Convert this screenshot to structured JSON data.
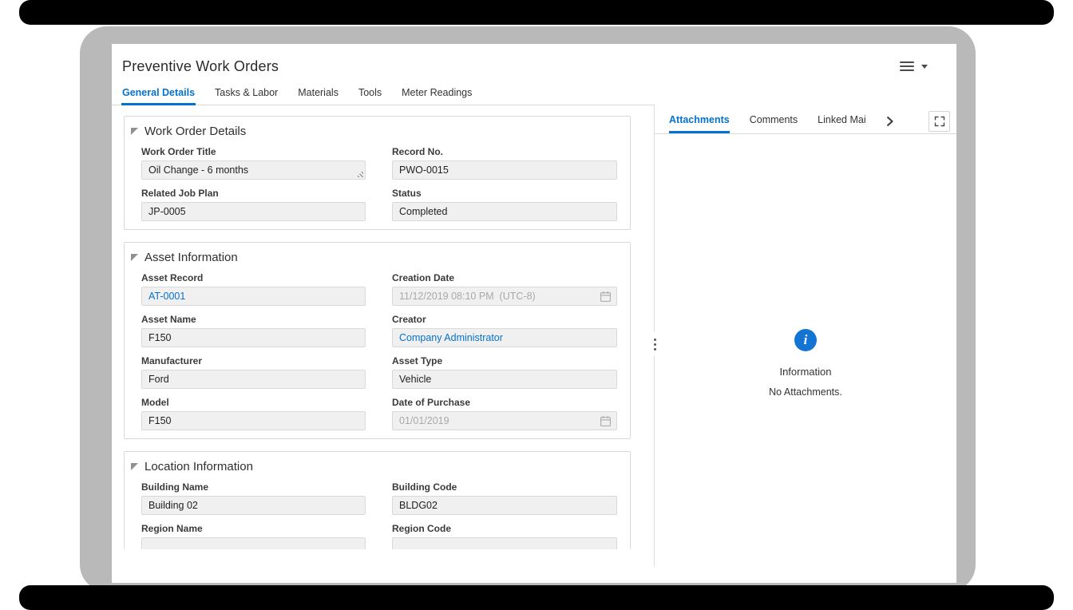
{
  "header": {
    "title": "Preventive Work Orders"
  },
  "main_tabs": [
    {
      "label": "General Details",
      "active": true
    },
    {
      "label": "Tasks & Labor",
      "active": false
    },
    {
      "label": "Materials",
      "active": false
    },
    {
      "label": "Tools",
      "active": false
    },
    {
      "label": "Meter Readings",
      "active": false
    }
  ],
  "form": {
    "sections": [
      {
        "title": "Work Order Details",
        "fields": [
          {
            "label": "Work Order Title",
            "value": "Oil Change - 6 months",
            "control": "textarea"
          },
          {
            "label": "Record No.",
            "value": "PWO-0015",
            "control": "text"
          },
          {
            "label": "Related Job Plan",
            "value": "JP-0005",
            "control": "text"
          },
          {
            "label": "Status",
            "value": "Completed",
            "control": "text"
          }
        ]
      },
      {
        "title": "Asset Information",
        "fields": [
          {
            "label": "Asset Record",
            "value": "AT-0001",
            "control": "link"
          },
          {
            "label": "Creation Date",
            "value": "11/12/2019 08:10 PM  (UTC-8)",
            "control": "date-disabled"
          },
          {
            "label": "Asset Name",
            "value": "F150",
            "control": "text"
          },
          {
            "label": "Creator",
            "value": "Company Administrator",
            "control": "link"
          },
          {
            "label": "Manufacturer",
            "value": "Ford",
            "control": "text"
          },
          {
            "label": "Asset Type",
            "value": "Vehicle",
            "control": "text"
          },
          {
            "label": "Model",
            "value": "F150",
            "control": "text"
          },
          {
            "label": "Date of Purchase",
            "value": "01/01/2019",
            "control": "date-disabled"
          }
        ]
      },
      {
        "title": "Location Information",
        "fields": [
          {
            "label": "Building Name",
            "value": "Building 02",
            "control": "text"
          },
          {
            "label": "Building Code",
            "value": "BLDG02",
            "control": "text"
          },
          {
            "label": "Region Name",
            "value": "",
            "control": "text"
          },
          {
            "label": "Region Code",
            "value": "",
            "control": "text"
          }
        ]
      }
    ]
  },
  "side_panel": {
    "tabs": [
      {
        "label": "Attachments",
        "active": true
      },
      {
        "label": "Comments",
        "active": false
      },
      {
        "label": "Linked Mai",
        "active": false
      }
    ],
    "empty_state": {
      "title": "Information",
      "message": "No Attachments."
    }
  },
  "icons": {
    "info_glyph": "i",
    "menu": "hamburger-icon",
    "tab_overflow": "chevron-right-icon",
    "maximize": "expand-icon",
    "date": "calendar-icon"
  },
  "colors": {
    "accent": "#0572ce",
    "info_blue": "#1474d4",
    "frame_gray": "#b9b9b9"
  }
}
